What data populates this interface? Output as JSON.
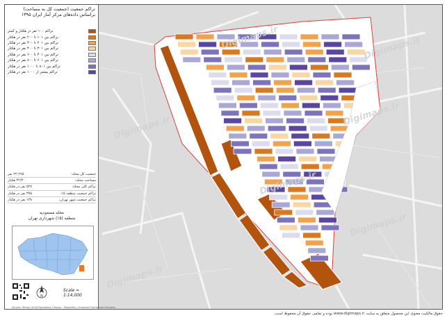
{
  "title": {
    "line1": "تراکم جمعیت (جمعیت کل به مساحت)",
    "line2": "براساس داده‌های مرکز آمار ایران ۱۳۹۵"
  },
  "legend": [
    {
      "label": "تراکم ۱۰۰ نفر در هکتار و کمتر",
      "color": "#b3540e"
    },
    {
      "label": "تراکم بین ۱۰۱ تا ۲۰۰ نفر در هکتار",
      "color": "#d8781f"
    },
    {
      "label": "تراکم بین ۲۰۱ تا ۳۰۰ نفر در هکتار",
      "color": "#f2a24c"
    },
    {
      "label": "تراکم بین ۳۰۱ تا ۴۰۰ نفر در هکتار",
      "color": "#fbd6a5"
    },
    {
      "label": "تراکم بین ۴۰۱ تا ۶۰۰ نفر در هکتار",
      "color": "#dcdcee"
    },
    {
      "label": "تراکم بین ۶۰۱ تا ۸۰۰ نفر در هکتار",
      "color": "#a9a7d6"
    },
    {
      "label": "تراکم بین ۸۰۱ تا ۱۰۰۰ نفر در هکتار",
      "color": "#7d73bd"
    },
    {
      "label": "تراکم بیشتر از ۱۰۰۰ نفر در هکتار",
      "color": "#5a46a0"
    }
  ],
  "stats": [
    {
      "label": "جمعیت کل محله:",
      "value": "۲۲,۲۹۵ نفر"
    },
    {
      "label": "مساحت محله:",
      "value": "۴۲/۳ هکتار"
    },
    {
      "label": "تراکم کلی محله:",
      "value": "۵۲۷ نفر در هکتار"
    },
    {
      "label": "تراکم جمعیت منطقه ۱۵:",
      "value": "۳۷۵ نفر در هکتار"
    },
    {
      "label": "تراکم جمعیت شهر تهران:",
      "value": "۱۳۸ نفر در هکتار"
    }
  ],
  "location": {
    "neighborhood": "محله مسعودیه",
    "district": "منطقه (۱۵) شهرداری تهران"
  },
  "scale": "Scale = 1:14,000",
  "north_label": "N",
  "footer_note": "Source: Tehran 2016 Population Census - Projection: Universal Transverse Mercator",
  "copyright": "حقوق مالکیت معنوی این محصول متعلق به سایت www.digimaps.ir بوده و تمامی حقوق آن محفوظ است.",
  "watermark": "Digimaps.ir",
  "colors": {
    "boundary": "#e23b3b",
    "map_bg": "#dcdcdc",
    "road": "#f7f7f7",
    "district_fill": "#9ec5f0",
    "inset_marker": "#e8772a"
  }
}
